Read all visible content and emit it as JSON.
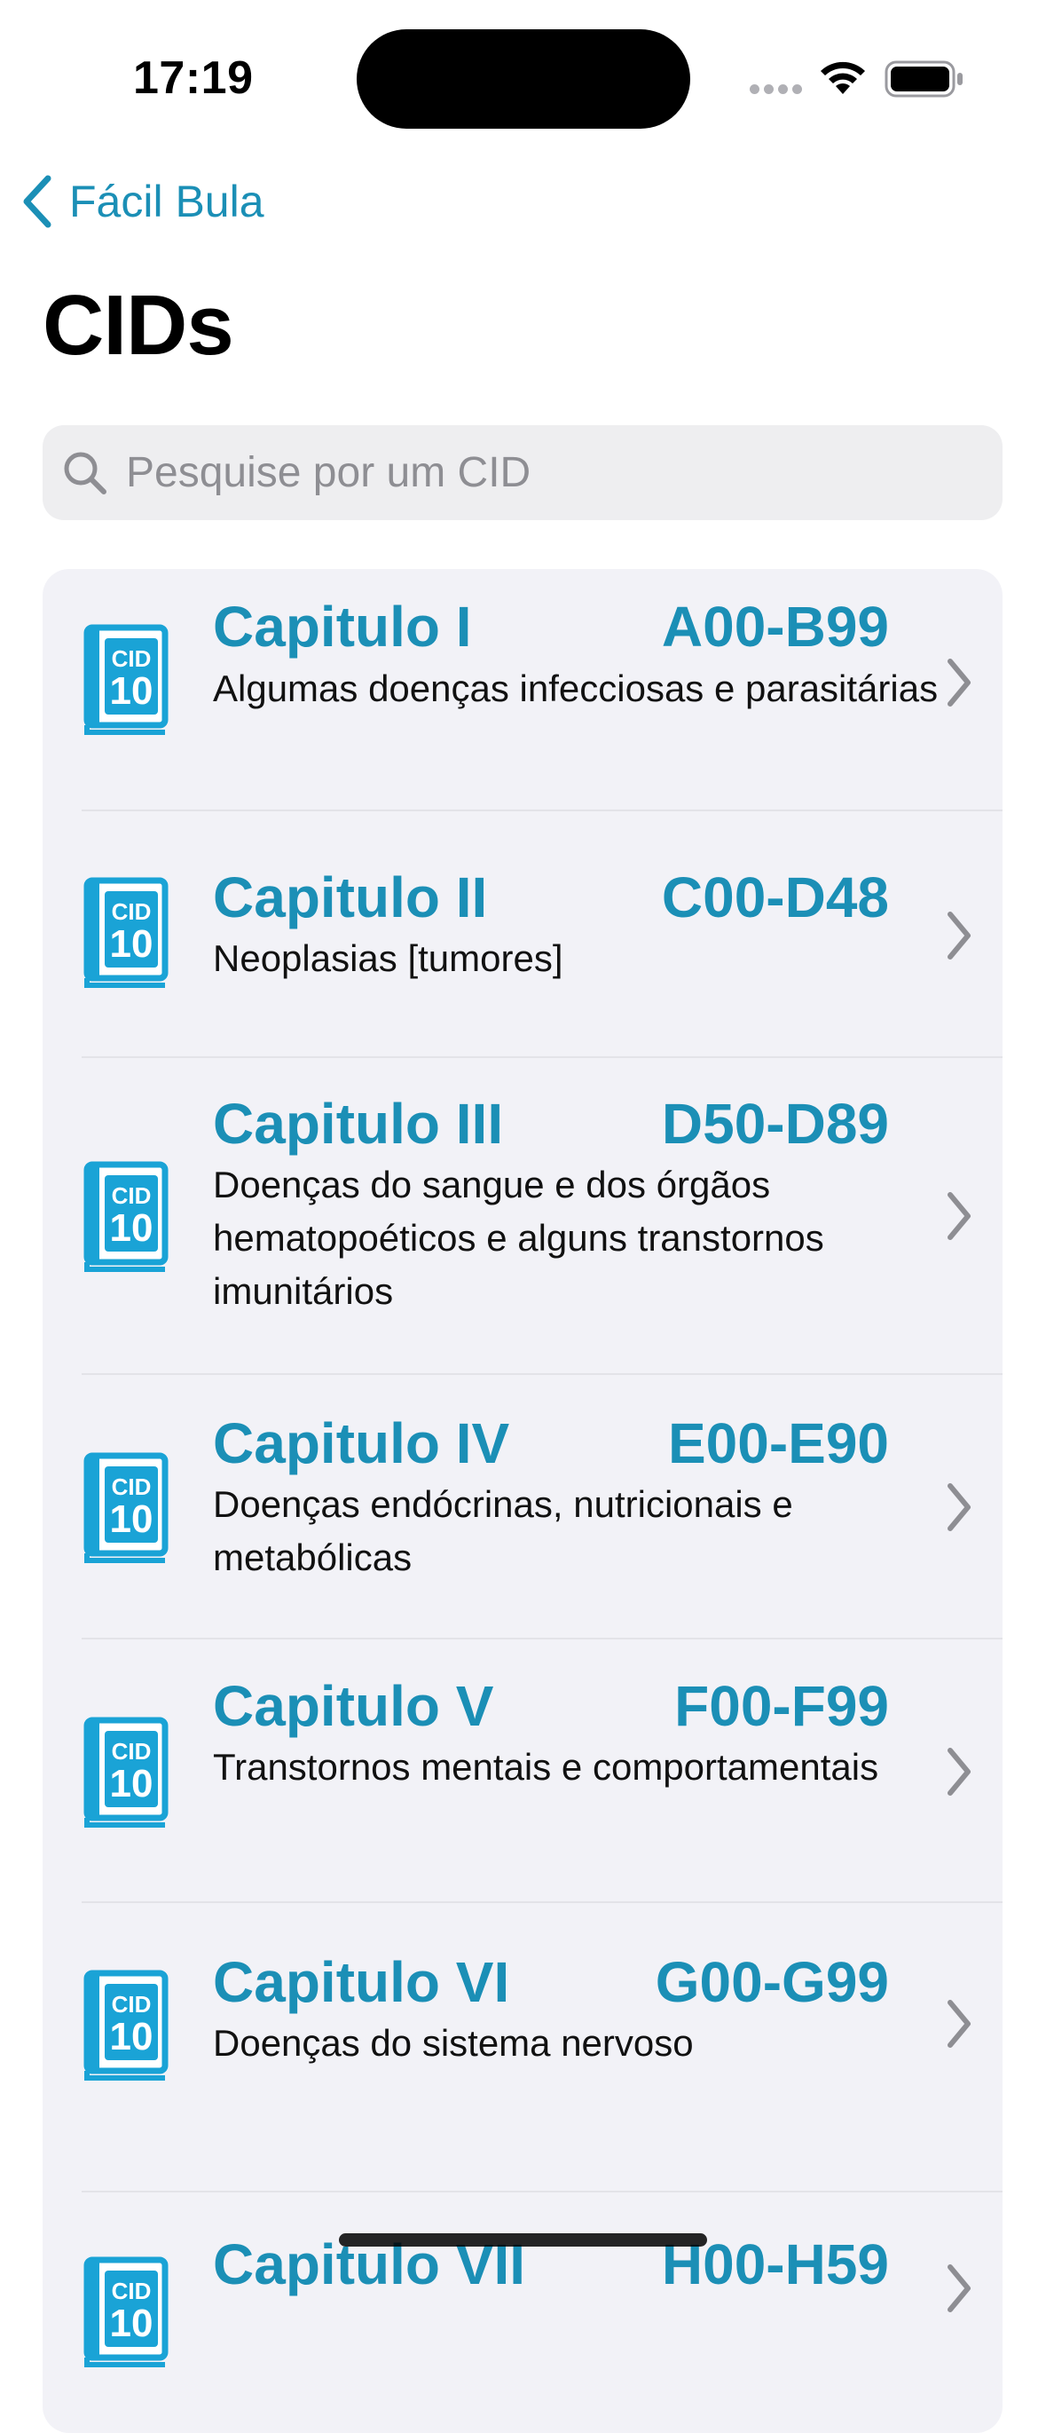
{
  "status_bar": {
    "time": "17:19"
  },
  "nav": {
    "back_label": "Fácil Bula",
    "title": "CIDs"
  },
  "search": {
    "placeholder": "Pesquise por um CID"
  },
  "icon_text": {
    "top": "CID",
    "bottom": "10"
  },
  "colors": {
    "accent": "#1b8fb6",
    "icon_blue": "#1aa3d6",
    "list_bg": "#f2f2f7"
  },
  "chapters": [
    {
      "title": "Capitulo I",
      "range": "A00-B99",
      "desc": "Algumas doenças infecciosas e parasitárias"
    },
    {
      "title": "Capitulo II",
      "range": "C00-D48",
      "desc": "Neoplasias [tumores]"
    },
    {
      "title": "Capitulo III",
      "range": "D50-D89",
      "desc": "Doenças do sangue e dos órgãos hematopoéticos e alguns transtornos imunitários"
    },
    {
      "title": "Capitulo IV",
      "range": "E00-E90",
      "desc": "Doenças endócrinas, nutricionais e metabólicas"
    },
    {
      "title": "Capitulo V",
      "range": "F00-F99",
      "desc": "Transtornos mentais e comportamentais"
    },
    {
      "title": "Capitulo VI",
      "range": "G00-G99",
      "desc": "Doenças do sistema nervoso"
    },
    {
      "title": "Capitulo VII",
      "range": "H00-H59",
      "desc": ""
    }
  ]
}
